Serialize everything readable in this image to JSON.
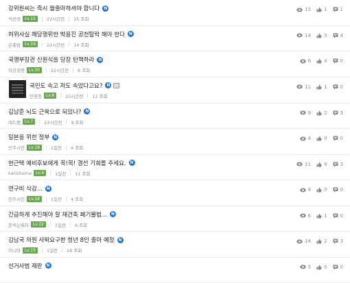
{
  "posts": [
    {
      "title": "강위원씨는 즉시 월출마하셔야 합니다",
      "author": "석선생",
      "level": "Lv.15",
      "time": "22시간전",
      "views": "15 조회",
      "stat_views": "15",
      "stat_likes": "1",
      "stat_comments": "1",
      "thumb": false,
      "img": false
    },
    {
      "title": "허위사실 해당행위한 박용진 공천탈락 해야 한다",
      "author": "은총맘",
      "level": "Lv.19",
      "time": "22시간전",
      "views": "14 조회",
      "stat_views": "14",
      "stat_likes": "5",
      "stat_comments": "4",
      "thumb": false,
      "img": false
    },
    {
      "title": "국행부장관 신원식을 당장 탄핵하라",
      "author": "자강공명",
      "level": "Lv.30",
      "time": "22시간전",
      "views": "6 조회",
      "stat_views": "6",
      "stat_likes": "4",
      "stat_comments": "0",
      "thumb": false,
      "img": false
    },
    {
      "title": "국민도 속고 저도 속았다고요?",
      "author": "민영칭",
      "level": "Lv.8",
      "time": "23시간전",
      "views": "11 조회",
      "stat_views": "11",
      "stat_likes": "1",
      "stat_comments": "0",
      "thumb": true,
      "img": true
    },
    {
      "title": "김남준 뇌도 근육으로 되있나?",
      "author": "레드펜",
      "level": "Lv.7",
      "time": "23시간전",
      "views": "9 조회",
      "stat_views": "9",
      "stat_likes": "2",
      "stat_comments": "3",
      "thumb": false,
      "img": false
    },
    {
      "title": "일본을 위한 정부",
      "author": "민주시민",
      "level": "Lv.18",
      "time": "1일전",
      "views": "4 조회",
      "stat_views": "4",
      "stat_likes": "0",
      "stat_comments": "0",
      "thumb": false,
      "img": false
    },
    {
      "title": "현근택 예비후보에게 꼭!꼭! 경선 기회를 주세요.",
      "author": "karishuma",
      "level": "Lv.4",
      "time": "1일전",
      "views": "11 조회",
      "stat_views": "11",
      "stat_likes": "9",
      "stat_comments": "3",
      "thumb": false,
      "img": false
    },
    {
      "title": "연구비 삭감...",
      "author": "민주시민",
      "level": "Lv.18",
      "time": "1일전",
      "views": "4 조회",
      "stat_views": "4",
      "stat_likes": "0",
      "stat_comments": "0",
      "thumb": false,
      "img": false
    },
    {
      "title": "긴급하게 추진해야 할 재건축 폐기물법...",
      "author": "돈먹는돼지",
      "level": "Lv.22",
      "time": "1일전",
      "views": "6 조회",
      "stat_views": "6",
      "stat_likes": "1",
      "stat_comments": "0",
      "thumb": false,
      "img": false
    },
    {
      "title": "김남국 의원 사퇴요구한 청년 8인 출마 예정",
      "author": "이니마",
      "level": "Lv.15",
      "time": "1일전",
      "views": "18 조회",
      "stat_views": "18",
      "stat_likes": "2",
      "stat_comments": "3",
      "thumb": false,
      "img": false
    },
    {
      "title": "선거사범 재판",
      "author": "",
      "level": "",
      "time": "",
      "views": "",
      "stat_views": "5",
      "stat_likes": "0",
      "stat_comments": "0",
      "thumb": false,
      "img": false
    }
  ],
  "new_badge": "N",
  "colors": {
    "level_badge": "#6aa84f",
    "new_badge": "#1e6fd9",
    "text_muted": "#888888"
  }
}
